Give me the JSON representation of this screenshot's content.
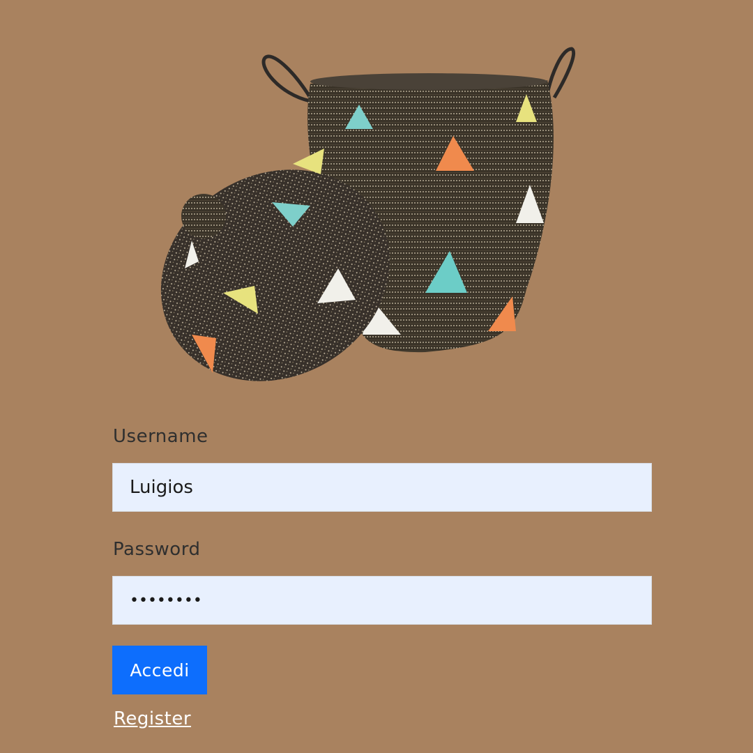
{
  "hero": {
    "image_icon": "lidded-woven-basket-image"
  },
  "login_form": {
    "username_label": "Username",
    "username_value": "Luigios",
    "password_label": "Password",
    "password_value": "••••••••",
    "submit_label": "Accedi",
    "register_label": "Register"
  },
  "colors": {
    "background": "#a9825f",
    "input_background": "#e8f0fe",
    "primary_button": "#0d6efd",
    "link": "#ffffff"
  }
}
